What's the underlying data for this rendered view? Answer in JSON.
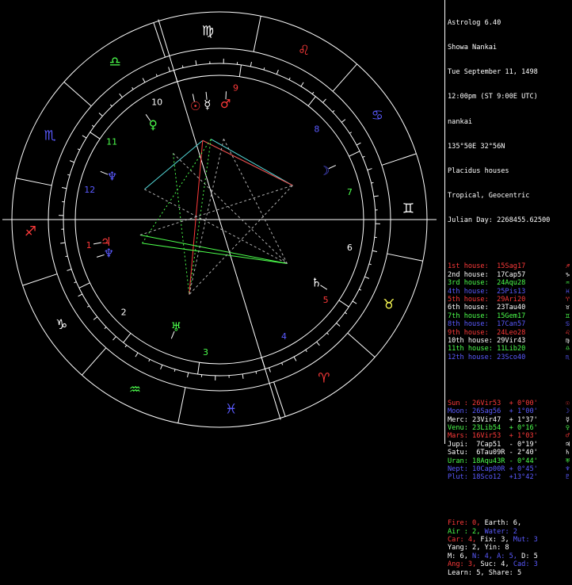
{
  "colors": {
    "white": "#ffffff",
    "red": "#ff3a3a",
    "green": "#4cff4c",
    "blue": "#5a5aff",
    "cyan": "#55dddd",
    "yellow": "#ffff55",
    "magenta": "#ff44ff",
    "gray": "#b0b0b0"
  },
  "header": {
    "app": "Astrolog 6.40",
    "name": "Showa Nankai",
    "date": "Tue September 11, 1498",
    "time": "12:00pm (ST 9:00E UTC)",
    "place": "nankai",
    "coords": "135°50E 32°56N",
    "house_system": "Placidus houses",
    "zodiac": "Tropical, Geocentric",
    "julian": "Julian Day: 2268455.62500"
  },
  "houses": [
    {
      "label": "1st house:",
      "value": "15Sag17",
      "color": "red",
      "glyph": "♐"
    },
    {
      "label": "2nd house:",
      "value": "17Cap57",
      "color": "white",
      "glyph": "♑"
    },
    {
      "label": "3rd house:",
      "value": "24Aqu28",
      "color": "green",
      "glyph": "♒"
    },
    {
      "label": "4th house:",
      "value": "25Pis13",
      "color": "blue",
      "glyph": "♓"
    },
    {
      "label": "5th house:",
      "value": "29Ari20",
      "color": "red",
      "glyph": "♈"
    },
    {
      "label": "6th house:",
      "value": "23Tau40",
      "color": "white",
      "glyph": "♉"
    },
    {
      "label": "7th house:",
      "value": "15Gem17",
      "color": "green",
      "glyph": "♊"
    },
    {
      "label": "8th house:",
      "value": "17Can57",
      "color": "blue",
      "glyph": "♋"
    },
    {
      "label": "9th house:",
      "value": "24Leo28",
      "color": "red",
      "glyph": "♌"
    },
    {
      "label": "10th house:",
      "value": "29Vir43",
      "color": "white",
      "glyph": "♍"
    },
    {
      "label": "11th house:",
      "value": "11Lib20",
      "color": "green",
      "glyph": "♎"
    },
    {
      "label": "12th house:",
      "value": "23Sco40",
      "color": "blue",
      "glyph": "♏"
    }
  ],
  "planets": [
    {
      "label": "Sun :",
      "pos": "26Vir53",
      "dev": "+ 0°00'",
      "color": "red",
      "glyph": "☉"
    },
    {
      "label": "Moon:",
      "pos": "26Sag56",
      "dev": "+ 1°00'",
      "color": "blue",
      "glyph": "☽"
    },
    {
      "label": "Merc:",
      "pos": "23Vir47",
      "dev": "+ 1°37'",
      "color": "white",
      "glyph": "☿"
    },
    {
      "label": "Venu:",
      "pos": "23Lib54",
      "dev": "+ 0°16'",
      "color": "green",
      "glyph": "♀"
    },
    {
      "label": "Mars:",
      "pos": "16Vir53",
      "dev": "+ 1°03'",
      "color": "red",
      "glyph": "♂"
    },
    {
      "label": "Jupi:",
      "pos": " 7Cap51",
      "dev": "- 0°19'",
      "color": "white",
      "glyph": "♃"
    },
    {
      "label": "Satu:",
      "pos": " 6Tau09R",
      "dev": "- 2°40'",
      "color": "white",
      "glyph": "♄"
    },
    {
      "label": "Uran:",
      "pos": "18Aqu43R",
      "dev": "- 0°44'",
      "color": "green",
      "glyph": "♅"
    },
    {
      "label": "Nept:",
      "pos": "10Cap00R",
      "dev": "+ 0°45'",
      "color": "blue",
      "glyph": "♆"
    },
    {
      "label": "Plut:",
      "pos": "18Sco12",
      "dev": "+13°42'",
      "color": "blue",
      "glyph": "♇"
    }
  ],
  "stats": [
    [
      {
        "t": "Fire: 0, ",
        "c": "red"
      },
      {
        "t": "Earth: 6,",
        "c": "white"
      }
    ],
    [
      {
        "t": "Air : 2, ",
        "c": "green"
      },
      {
        "t": "Water: 2",
        "c": "blue"
      }
    ],
    [
      {
        "t": "Car: 4, ",
        "c": "red"
      },
      {
        "t": "Fix: 3, ",
        "c": "white"
      },
      {
        "t": "Mut: 3",
        "c": "blue"
      }
    ],
    [
      {
        "t": "Yang: 2, Yin: 8",
        "c": "white"
      }
    ],
    [
      {
        "t": "M: 6, ",
        "c": "white"
      },
      {
        "t": "N: 4, ",
        "c": "blue"
      },
      {
        "t": "A: 5, ",
        "c": "blue"
      },
      {
        "t": "D: 5",
        "c": "white"
      }
    ],
    [
      {
        "t": "Ang: 3, ",
        "c": "red"
      },
      {
        "t": "Suc: 4, ",
        "c": "white"
      },
      {
        "t": "Cad: 3",
        "c": "blue"
      }
    ],
    [
      {
        "t": "Learn: 5, Share: 5",
        "c": "white"
      }
    ]
  ],
  "wheel": {
    "signs": [
      {
        "glyph": "♍",
        "angle": 93.5,
        "color": "white"
      },
      {
        "glyph": "♌",
        "angle": 63.5,
        "color": "red"
      },
      {
        "glyph": "♋",
        "angle": 33.5,
        "color": "blue"
      },
      {
        "glyph": "♊",
        "angle": 3.5,
        "color": "white"
      },
      {
        "glyph": "♉",
        "angle": -26.5,
        "color": "yellow"
      },
      {
        "glyph": "♈",
        "angle": -56.5,
        "color": "red"
      },
      {
        "glyph": "♓",
        "angle": -86.5,
        "color": "blue"
      },
      {
        "glyph": "♒",
        "angle": -116.5,
        "color": "green"
      },
      {
        "glyph": "♑",
        "angle": -146.5,
        "color": "white"
      },
      {
        "glyph": "♐",
        "angle": -176.5,
        "color": "red"
      },
      {
        "glyph": "♏",
        "angle": 153.5,
        "color": "blue"
      },
      {
        "glyph": "♎",
        "angle": 123.5,
        "color": "green"
      }
    ],
    "house_numbers": [
      {
        "n": "1",
        "angle": -169,
        "color": "red"
      },
      {
        "n": "2",
        "angle": -136,
        "color": "white"
      },
      {
        "n": "3",
        "angle": -96,
        "color": "green"
      },
      {
        "n": "4",
        "angle": -61,
        "color": "blue"
      },
      {
        "n": "5",
        "angle": -37,
        "color": "red"
      },
      {
        "n": "6",
        "angle": -12,
        "color": "white"
      },
      {
        "n": "7",
        "angle": 12,
        "color": "green"
      },
      {
        "n": "8",
        "angle": 43,
        "color": "blue"
      },
      {
        "n": "9",
        "angle": 83,
        "color": "red"
      },
      {
        "n": "10",
        "angle": 118,
        "color": "white"
      },
      {
        "n": "11",
        "angle": 144,
        "color": "green"
      },
      {
        "n": "12",
        "angle": 167,
        "color": "blue"
      }
    ],
    "planet_marks": [
      {
        "glyph": "☉",
        "angle": 102,
        "color": "red"
      },
      {
        "glyph": "☿",
        "angle": 96,
        "color": "white"
      },
      {
        "glyph": "♂",
        "angle": 87,
        "color": "red"
      },
      {
        "glyph": "♀",
        "angle": 125,
        "color": "green"
      },
      {
        "glyph": "☽",
        "angle": 25,
        "color": "blue"
      },
      {
        "glyph": "♆",
        "angle": 158,
        "color": "blue"
      },
      {
        "glyph": "♃",
        "angle": -169,
        "color": "red"
      },
      {
        "glyph": "♆",
        "angle": -163,
        "color": "blue"
      },
      {
        "glyph": "♅",
        "angle": -112,
        "color": "green"
      },
      {
        "glyph": "♄",
        "angle": -33,
        "color": "white"
      }
    ]
  }
}
